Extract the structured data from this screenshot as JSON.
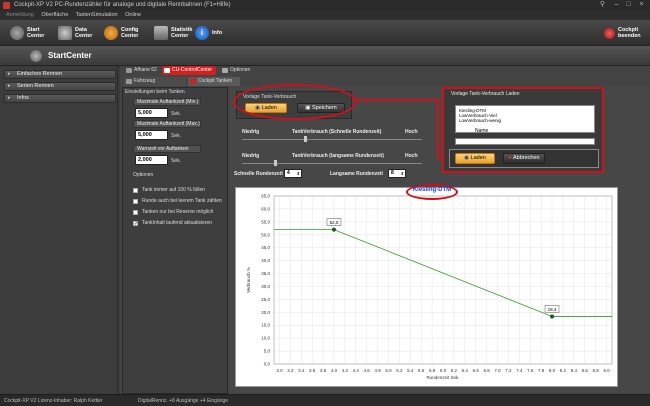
{
  "titlebar": {
    "title": "Cockpit-XP V2 PC-Rundenzähler für analoge und digitale Rennbahnen (F1=Hilfe)"
  },
  "menu": {
    "items": [
      "Anmeldung",
      "Oberfläche",
      "TastenSimulation",
      "Online"
    ]
  },
  "toolbar": {
    "buttons": [
      {
        "label": "Start\nCenter",
        "color": "#7a7a7a"
      },
      {
        "label": "Data\nCenter",
        "color": "#8a8a8a"
      },
      {
        "label": "Config\nCenter",
        "color": "#d88a18"
      },
      {
        "label": "Statistik\nCenter",
        "color": "#7a7a7a"
      },
      {
        "label": "Info",
        "color": "#1e6fd8"
      }
    ],
    "exit_label": "Cockpit\nbeenden"
  },
  "startcenter": {
    "title": "StartCenter"
  },
  "sidebar": {
    "items": [
      "Einfaches Rennen",
      "Serien Rennen",
      "Infos"
    ]
  },
  "tabs": {
    "top": [
      "Afhane 62",
      "CU-ControlCenter",
      "Optionen"
    ],
    "sub": [
      "Fahrzeug Einstellungen",
      "Cockpit Tanken"
    ]
  },
  "left_panel": {
    "header": "Einstellungen beim Tanken",
    "max_fuel_min_label": "Maximale Auftankzeit (Min.)",
    "max_fuel_min_value": "5,000",
    "max_fuel_max_label": "Maximale Auftankzeit (Max.)",
    "max_fuel_max_value": "5,000",
    "warn_label": "Warnzeit vor Auftanken",
    "warn_value": "2,000",
    "unit_sek": "Sek.",
    "options_header": "Optionen",
    "options": [
      {
        "label": "Tank immer auf 100 % füllen",
        "checked": false
      },
      {
        "label": "Runde auch bei leerem Tank zählen",
        "checked": false
      },
      {
        "label": "Tanken nur bei Reserve möglich",
        "checked": false
      },
      {
        "label": "TankInhalt laufend aktualisieren",
        "checked": true
      }
    ]
  },
  "vorlage": {
    "title": "Vorlage Tank-Verbrauch",
    "load_label": "Laden",
    "save_label": "Speichern"
  },
  "sliders": {
    "low": "Niedrig",
    "high": "Hoch",
    "fast_label": "TankVerbrauch (Schnelle Rundenzeit)",
    "slow_label": "TankVerbrauch (langsame Rundenzeit)",
    "fast_time_label": "Schnelle Rundenzeit",
    "fast_time_value": "4",
    "slow_time_label": "Langsame Rundenzeit",
    "slow_time_value": "8"
  },
  "dialog": {
    "title": "Vorlage Tank-Verbrauch  Laden",
    "list": [
      "Kiesling-DTM",
      "LowVerbrauch-Viel",
      "LowVerbrauch-wenig"
    ],
    "name_label": "Name",
    "load_label": "Laden",
    "cancel_label": "Abbrechen"
  },
  "chart_data": {
    "type": "line",
    "title": "Kiesling-DTM",
    "xlabel": "Rundenzeit Sek.",
    "ylabel": "Verbrauch %",
    "x_ticks": [
      "3.0",
      "3.2",
      "3.4",
      "3.6",
      "3.8",
      "4.0",
      "4.2",
      "4.4",
      "4.6",
      "4.8",
      "5.0",
      "5.2",
      "5.4",
      "5.6",
      "5.8",
      "6.0",
      "6.2",
      "6.4",
      "6.6",
      "6.8",
      "7.0",
      "7.2",
      "7.4",
      "7.6",
      "7.8",
      "8.0",
      "8.2",
      "8.4",
      "8.6",
      "8.8",
      "9.0"
    ],
    "y_ticks": [
      "65,0",
      "60,0",
      "55,0",
      "50,0",
      "45,0",
      "40,0",
      "35,0",
      "30,0",
      "25,0",
      "20,0",
      "15,0",
      "10,0",
      "5,0",
      "0,0"
    ],
    "xlim": [
      2.9,
      9.1
    ],
    "ylim": [
      0,
      65
    ],
    "points": [
      {
        "x": 2.9,
        "y": 52.0,
        "label": ""
      },
      {
        "x": 4.0,
        "y": 52.0,
        "label": "52,0"
      },
      {
        "x": 8.0,
        "y": 18.4,
        "label": "18,4"
      },
      {
        "x": 9.1,
        "y": 18.4,
        "label": ""
      }
    ],
    "line_color": "#2e9e2e"
  },
  "status": {
    "license": "Cockpit-XP V2 Lizenz-Inhaber: Ralph Kettler",
    "digital": "DigitalRennz. +8 Ausgänge +4 Eingänge"
  }
}
